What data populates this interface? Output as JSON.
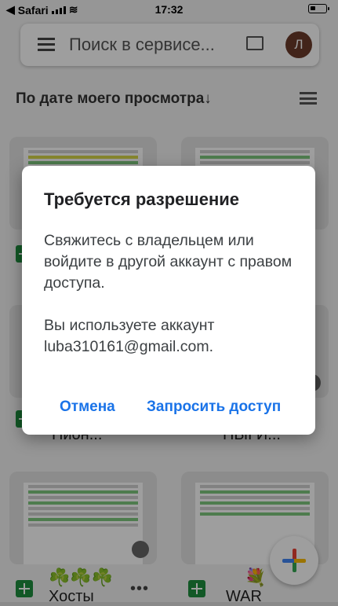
{
  "status_bar": {
    "back_app": "Safari",
    "time": "17:32"
  },
  "search": {
    "placeholder": "Поиск в сервисе...",
    "avatar_letter": "Л"
  },
  "sort": {
    "label": "По дате моего просмотра",
    "arrow": "↓"
  },
  "files": [
    {
      "title": ""
    },
    {
      "title": ""
    },
    {
      "title": "Пион..."
    },
    {
      "title": "ПЫГИ..."
    },
    {
      "title": "Хосты",
      "emoji": "☘️☘️☘️"
    },
    {
      "title": "WAR",
      "emoji": "💐"
    }
  ],
  "more_label": "•••",
  "dialog": {
    "title": "Требуется разрешение",
    "message": "Свяжитесь с владельцем или войдите в другой аккаунт с правом доступа.",
    "account_line": "Вы используете аккаунт luba310161@gmail.com.",
    "cancel_label": "Отмена",
    "request_label": "Запросить доступ"
  },
  "colors": {
    "accent": "#1a73e8",
    "sheets_green": "#1e8e3e"
  }
}
